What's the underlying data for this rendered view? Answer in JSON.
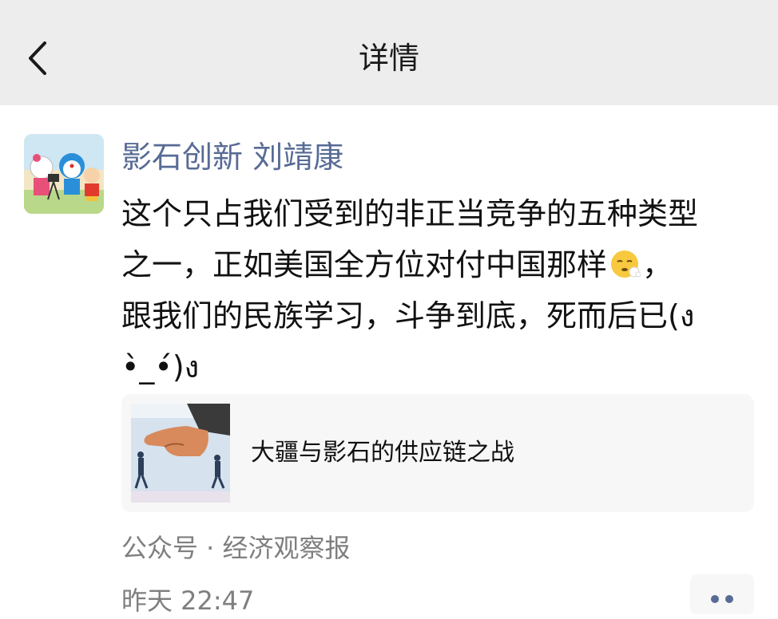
{
  "nav": {
    "title": "详情",
    "back_icon": "chevron-left-icon"
  },
  "post": {
    "author": "影石创新 刘靖康",
    "content_lines": [
      "这个只占我们受到的非正当竞争的五种类型",
      "之一，正如美国全方位对付中国那样",
      "，",
      "跟我们的民族学习，斗争到底，死而后已(ง",
      "•̀_•́)ง"
    ],
    "emoji": "sigh-emoji-icon",
    "link_card": {
      "title": "大疆与影石的供应链之战"
    },
    "source": "公众号 · 经济观察报",
    "time": "昨天 22:47",
    "more_icon": "more-dots-icon"
  },
  "colors": {
    "nav_bg": "#ededed",
    "link_blue": "#576b95",
    "text": "#111111",
    "meta_gray": "#7f7f7f",
    "card_bg": "#f7f7f7"
  }
}
